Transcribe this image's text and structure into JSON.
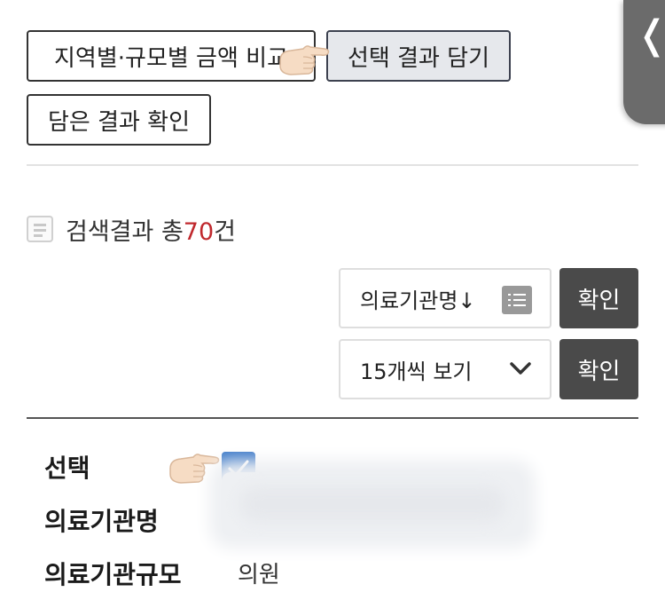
{
  "toolbar": {
    "compare_label": "지역별·규모별 금액 비교",
    "add_selected_label": "선택 결과 담기",
    "view_saved_label": "담은 결과 확인"
  },
  "side_tab": {
    "glyph": "❬"
  },
  "results": {
    "prefix": "검색결과 총",
    "count": "70",
    "suffix": "건"
  },
  "sort": {
    "selected": "의료기관명↓",
    "confirm_label": "확인"
  },
  "page_size": {
    "selected": "15개씩 보기",
    "confirm_label": "확인"
  },
  "record": {
    "select_label": "선택",
    "selected": true,
    "name_label": "의료기관명",
    "scale_label": "의료기관규모",
    "scale_value": "의원"
  },
  "colors": {
    "accent_count": "#c0282d",
    "checkbox": "#3a78c8",
    "dark_button": "#4a4a4a"
  }
}
